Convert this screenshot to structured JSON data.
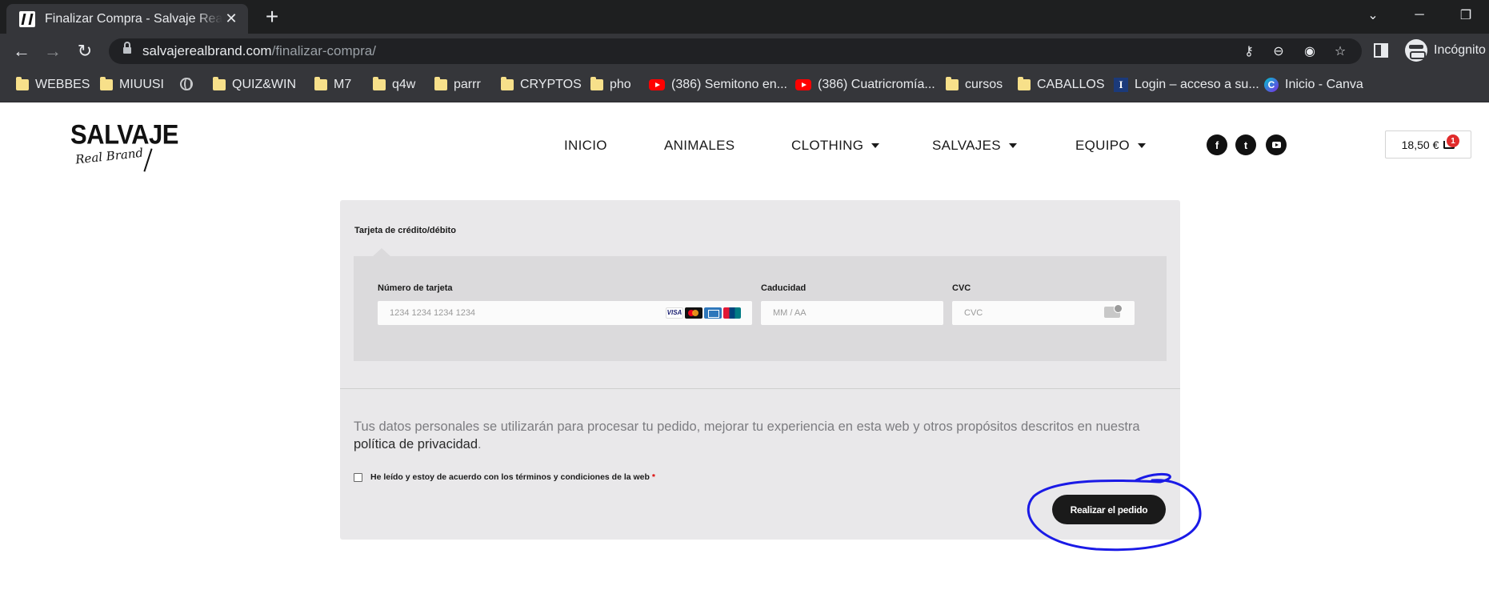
{
  "browser": {
    "tab_title": "Finalizar Compra - Salvaje Real Brand",
    "url_host": "salvajerealbrand.com",
    "url_path": "/finalizar-compra/",
    "profile_label": "Incógnito"
  },
  "bookmarks": [
    {
      "icon": "folder-icon",
      "label": "WEBBES"
    },
    {
      "icon": "folder-icon",
      "label": "MIUUSI"
    },
    {
      "icon": "globe-icon",
      "label": ""
    },
    {
      "icon": "folder-icon",
      "label": "QUIZ&WIN"
    },
    {
      "icon": "folder-icon",
      "label": "M7"
    },
    {
      "icon": "folder-icon",
      "label": "q4w"
    },
    {
      "icon": "folder-icon",
      "label": "parrr"
    },
    {
      "icon": "folder-icon",
      "label": "CRYPTOS"
    },
    {
      "icon": "folder-icon",
      "label": "pho"
    },
    {
      "icon": "youtube-icon",
      "label": "(386) Semitono en..."
    },
    {
      "icon": "youtube-icon",
      "label": "(386) Cuatricromía..."
    },
    {
      "icon": "folder-icon",
      "label": "cursos"
    },
    {
      "icon": "folder-icon",
      "label": "CABALLOS"
    },
    {
      "icon": "site-icon",
      "label": "Login – acceso a su..."
    },
    {
      "icon": "canva-icon",
      "label": "Inicio - Canva"
    }
  ],
  "site": {
    "logo_top": "SALVAJE",
    "logo_bottom": "Real Brand",
    "nav": [
      {
        "label": "INICIO",
        "has_dropdown": false
      },
      {
        "label": "ANIMALES",
        "has_dropdown": false
      },
      {
        "label": "CLOTHING",
        "has_dropdown": true
      },
      {
        "label": "SALVAJES",
        "has_dropdown": true
      },
      {
        "label": "EQUIPO",
        "has_dropdown": true
      }
    ],
    "social": [
      "facebook-icon",
      "twitter-icon",
      "youtube-icon"
    ],
    "cart_total": "18,50 €",
    "cart_count": "1"
  },
  "checkout": {
    "payment_method_label": "Tarjeta de crédito/débito",
    "card_number_label": "Número de tarjeta",
    "card_number_placeholder": "1234 1234 1234 1234",
    "card_brands": [
      "VISA",
      "Mastercard",
      "American Express",
      "UnionPay"
    ],
    "expiry_label": "Caducidad",
    "expiry_placeholder": "MM / AA",
    "cvc_label": "CVC",
    "cvc_placeholder": "CVC",
    "privacy_text": "Tus datos personales se utilizarán para procesar tu pedido, mejorar tu experiencia en esta web y otros propósitos descritos en nuestra ",
    "privacy_link": "política de privacidad",
    "privacy_end": ".",
    "terms_label": "He leído y estoy de acuerdo con los términos y condiciones de la web",
    "terms_required": "*",
    "terms_checked": false,
    "place_order_label": "Realizar el pedido"
  },
  "colors": {
    "card_bg": "#e9e8ea",
    "card_inner_bg": "#dbdadc",
    "button_bg": "#1a1a1a",
    "annotation": "#1a1ae6"
  }
}
